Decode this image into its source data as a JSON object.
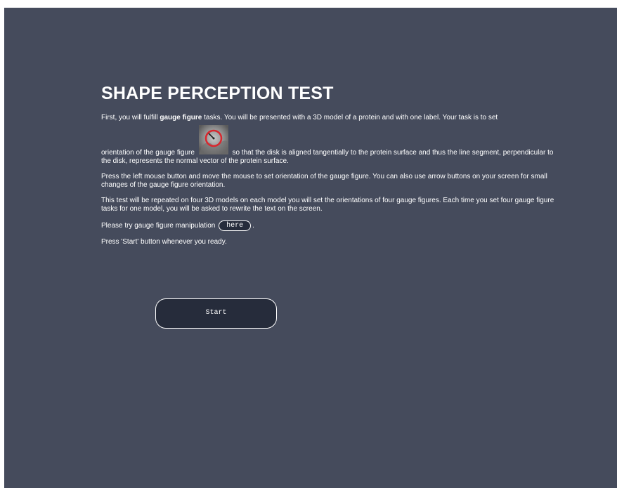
{
  "page": {
    "title": "SHAPE PERCEPTION TEST"
  },
  "intro": {
    "p1_prefix": "First, you will fulfill ",
    "p1_bold": "gauge figure",
    "p1_suffix": " tasks. You will be presented with a 3D model of a protein and with one label. Your task is to set",
    "p1b_prefix": "orientation of the gauge figure",
    "p1b_suffix": "so that the disk is aligned tangentially to the protein surface and thus the line segment, perpendicular to the disk, represents the normal vector of the protein surface.",
    "p2": "Press the left mouse button and move the mouse to set orientation of the gauge figure. You can also use arrow buttons on your screen for small changes of the gauge figure orientation.",
    "p3": "This test will be repeated on four 3D models on each model you will set the orientations of four gauge figures. Each time you set four gauge figure tasks for one model, you will be asked to rewrite the text on the screen.",
    "p4_prefix": "Please try gauge figure manipulation",
    "p4_suffix": ".",
    "here_label": "here",
    "p5": "Press 'Start' button whenever you ready."
  },
  "actions": {
    "start_label": "Start"
  },
  "colors": {
    "background": "#454b5c",
    "button_fill": "#262c3b",
    "text": "#ffffff",
    "gauge_ring": "#d9272e"
  }
}
